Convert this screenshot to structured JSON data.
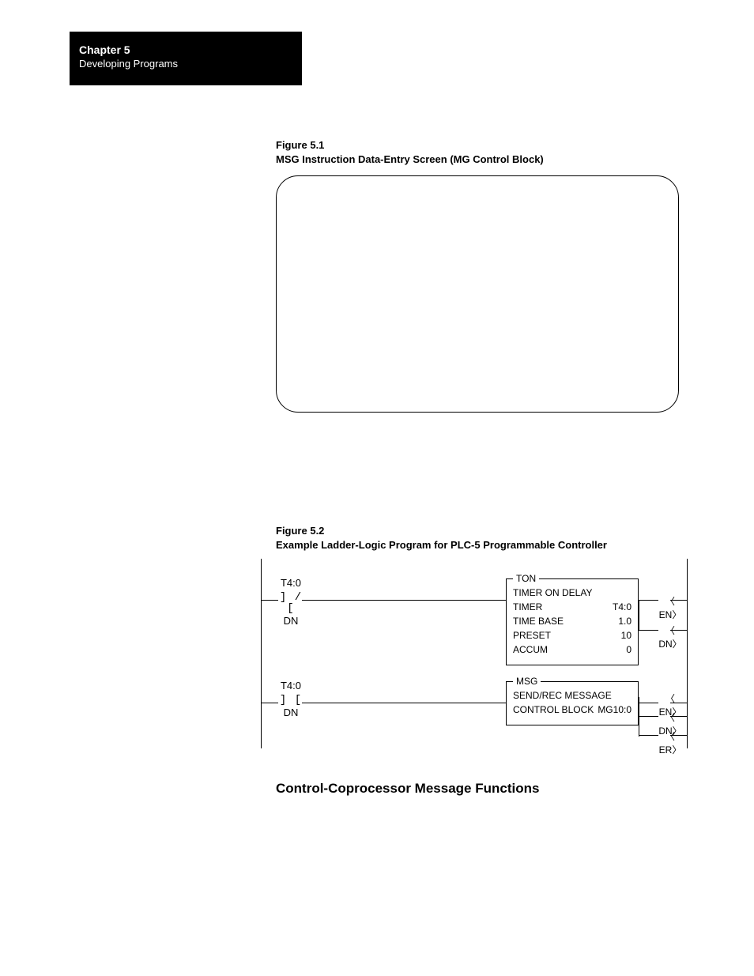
{
  "header": {
    "chapter": "Chapter  5",
    "title": "Developing Programs"
  },
  "figure1": {
    "num": "Figure 5.1",
    "caption": "MSG Instruction Data-Entry Screen (MG Control Block)"
  },
  "figure2": {
    "num": "Figure 5.2",
    "caption": "Example Ladder-Logic Program for PLC-5 Programmable Controller"
  },
  "ladder": {
    "rung1": {
      "contact": {
        "addr": "T4:0",
        "symbol": "] / [",
        "tag": "DN"
      },
      "block": {
        "title": "TON",
        "rows": [
          {
            "l": "TIMER ON DELAY",
            "r": ""
          },
          {
            "l": "TIMER",
            "r": "T4:0"
          },
          {
            "l": "TIME BASE",
            "r": "1.0"
          },
          {
            "l": "PRESET",
            "r": "10"
          },
          {
            "l": "ACCUM",
            "r": "0"
          }
        ]
      },
      "outputs": [
        "EN",
        "DN"
      ]
    },
    "rung2": {
      "contact": {
        "addr": "T4:0",
        "symbol": "]   [",
        "tag": "DN"
      },
      "block": {
        "title": "MSG",
        "rows": [
          {
            "l": "SEND/REC MESSAGE",
            "r": ""
          },
          {
            "l": "CONTROL BLOCK",
            "r": "MG10:0"
          }
        ]
      },
      "outputs": [
        "EN",
        "DN",
        "ER"
      ]
    }
  },
  "section_heading": "Control-Coprocessor Message Functions"
}
